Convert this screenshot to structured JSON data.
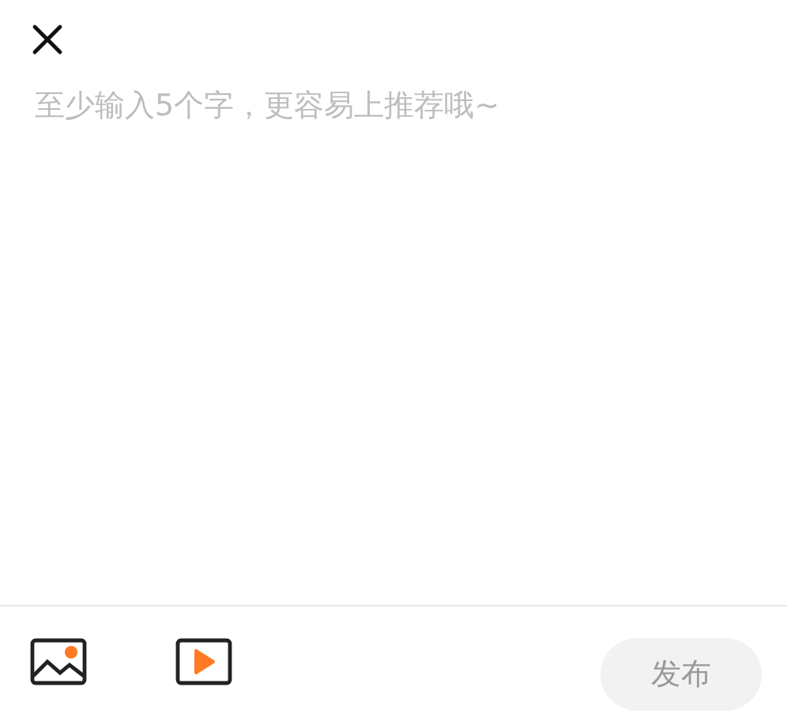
{
  "composer": {
    "placeholder": "至少输入5个字，更容易上推荐哦~"
  },
  "toolbar": {
    "publish_button": {
      "label": "发布",
      "disabled": true
    }
  }
}
